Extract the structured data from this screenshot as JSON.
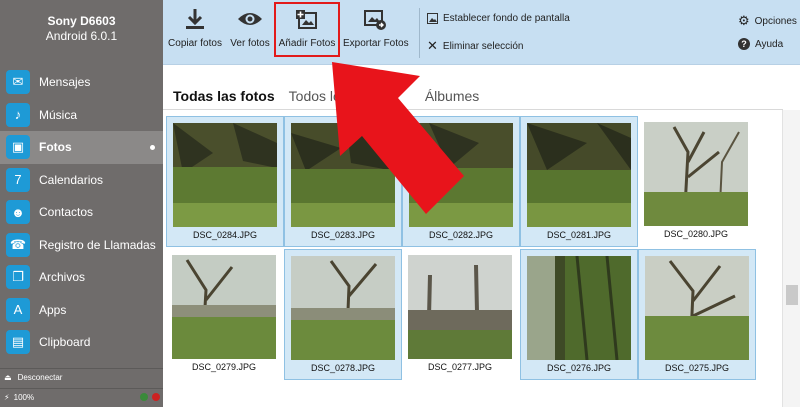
{
  "device": {
    "name": "Sony D6603",
    "os": "Android 6.0.1"
  },
  "sidebar": {
    "items": [
      {
        "label": "Mensajes",
        "icon": "chat-icon"
      },
      {
        "label": "Música",
        "icon": "music-note-icon"
      },
      {
        "label": "Fotos",
        "icon": "photos-icon"
      },
      {
        "label": "Calendarios",
        "icon": "calendar-icon"
      },
      {
        "label": "Contactos",
        "icon": "contacts-icon"
      },
      {
        "label": "Registro de Llamadas",
        "icon": "phone-icon"
      },
      {
        "label": "Archivos",
        "icon": "files-icon"
      },
      {
        "label": "Apps",
        "icon": "apps-icon"
      },
      {
        "label": "Clipboard",
        "icon": "clipboard-icon"
      }
    ],
    "active_index": 2,
    "disconnect_label": "Desconectar",
    "battery": "100%"
  },
  "toolbar": {
    "copy_label": "Copiar fotos",
    "view_label": "Ver fotos",
    "add_label": "Añadir Fotos",
    "export_label": "Exportar Fotos",
    "wallpaper_label": "Establecer fondo de pantalla",
    "delete_label": "Eliminar selección",
    "options_label": "Opciones",
    "help_label": "Ayuda"
  },
  "tabs": {
    "all": "Todas las fotos",
    "every": "Todos lo",
    "albums": "Álbumes"
  },
  "photos": [
    {
      "name": "DSC_0284.JPG",
      "selected": true
    },
    {
      "name": "DSC_0283.JPG",
      "selected": true
    },
    {
      "name": "DSC_0282.JPG",
      "selected": true
    },
    {
      "name": "DSC_0281.JPG",
      "selected": true
    },
    {
      "name": "DSC_0280.JPG",
      "selected": false
    },
    {
      "name": "DSC_0279.JPG",
      "selected": false
    },
    {
      "name": "DSC_0278.JPG",
      "selected": true
    },
    {
      "name": "DSC_0277.JPG",
      "selected": false
    },
    {
      "name": "DSC_0276.JPG",
      "selected": true
    },
    {
      "name": "DSC_0275.JPG",
      "selected": true
    }
  ],
  "colors": {
    "accent": "#1e9ad6",
    "sidebar": "#6f6c6b",
    "toolbar": "#c7dff2",
    "highlight": "#e21a1a",
    "selection": "#d3e8f6"
  }
}
